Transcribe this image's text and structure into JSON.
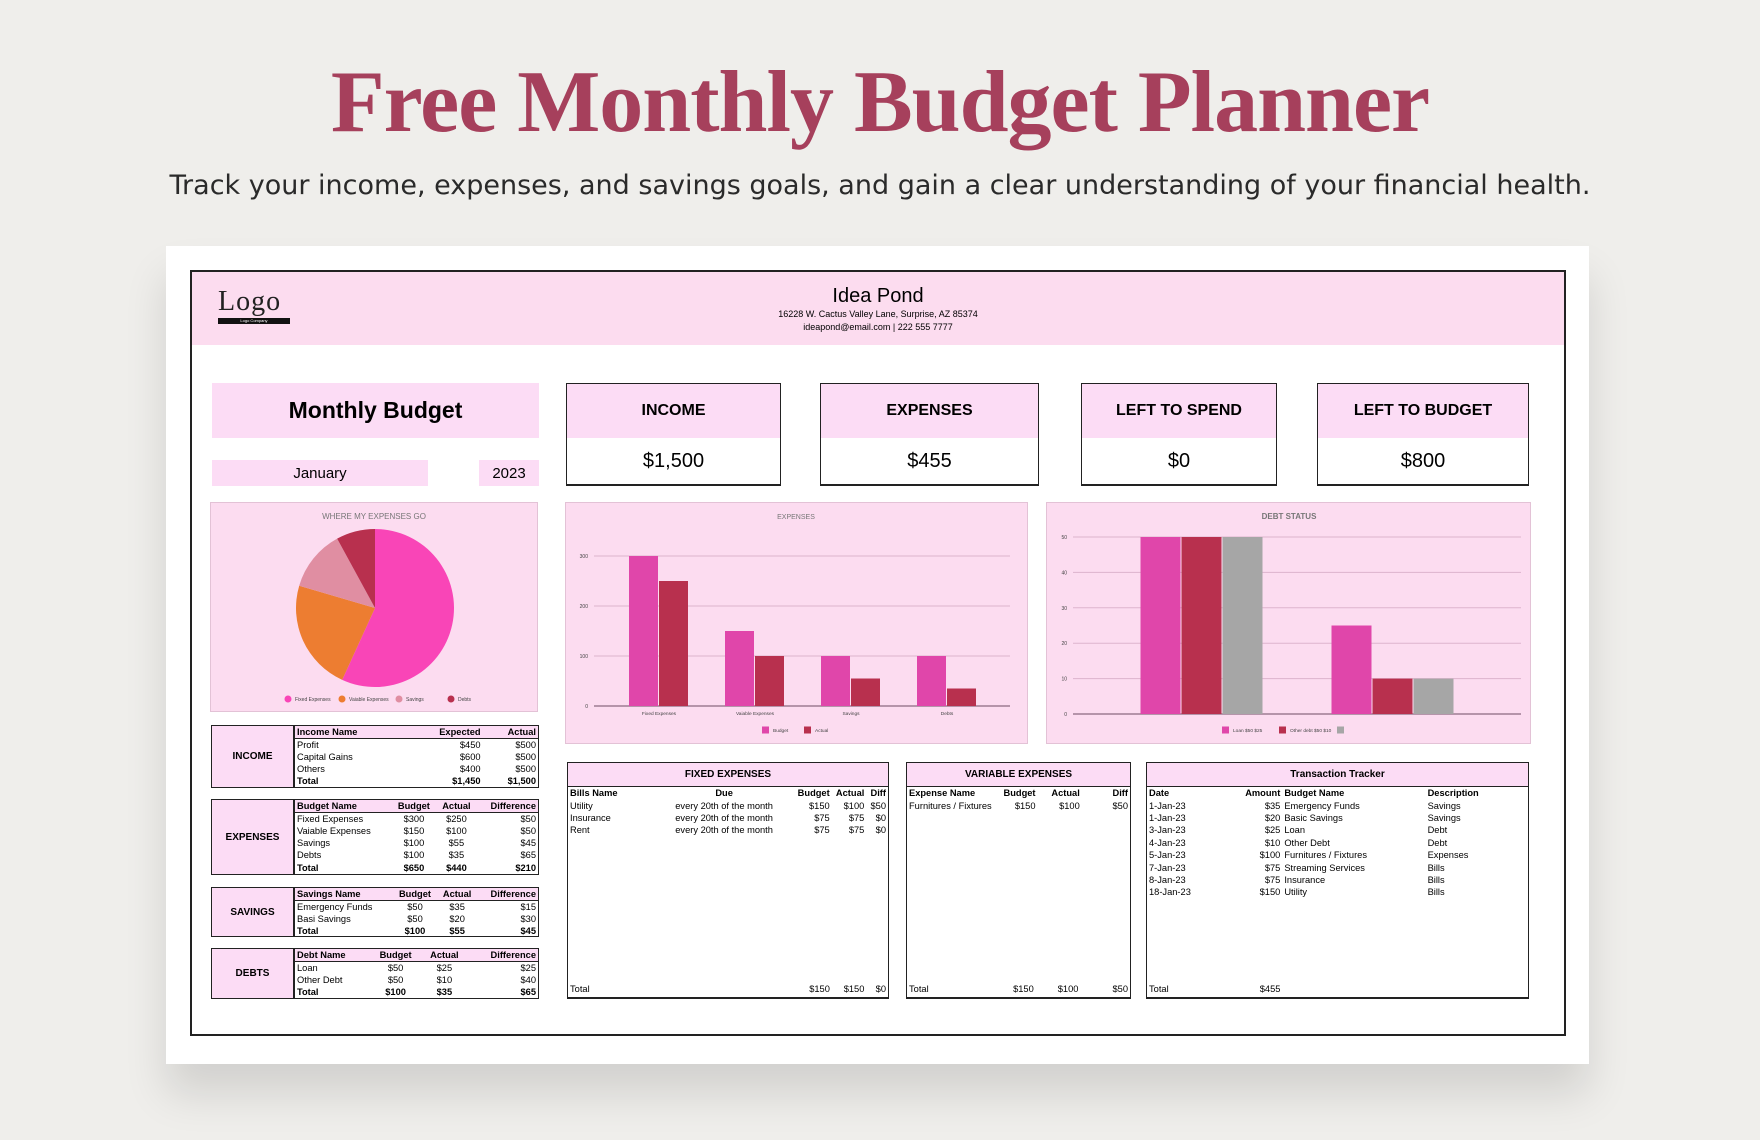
{
  "page": {
    "title": "Free Monthly Budget Planner",
    "subtitle": "Track your income, expenses, and savings goals, and gain a clear understanding of your financial health."
  },
  "header": {
    "logo": "Logo",
    "logo_tagline": "Logo Company",
    "company": "Idea Pond",
    "address": "16228 W. Cactus Valley Lane, Surprise, AZ 85374",
    "contact": "ideapond@email.com | 222 555 7777"
  },
  "budget": {
    "title": "Monthly Budget",
    "month": "January",
    "year": "2023"
  },
  "kpis": [
    {
      "label": "INCOME",
      "value": "$1,500"
    },
    {
      "label": "EXPENSES",
      "value": "$455"
    },
    {
      "label": "LEFT TO SPEND",
      "value": "$0"
    },
    {
      "label": "LEFT TO BUDGET",
      "value": "$800"
    }
  ],
  "colors": {
    "accent": "#a6405c",
    "pink_fill": "#fcdcf5",
    "series_pink": "#e046aa",
    "series_red": "#b8304e",
    "series_gray": "#a6a6a6"
  },
  "chart_data": [
    {
      "type": "pie",
      "title": "WHERE MY EXPENSES GO",
      "categories": [
        "Fixed Expenses",
        "Vaiable Expenses",
        "Savings",
        "Debts"
      ],
      "values": [
        250,
        100,
        55,
        35
      ],
      "colors": [
        "#f945b7",
        "#ed7d31",
        "#e08ea2",
        "#b8304e"
      ],
      "legend": "bottom"
    },
    {
      "type": "bar",
      "title": "EXPENSES",
      "categories": [
        "Fixed Expenses",
        "Vaiable Expenses",
        "Savings",
        "Debts"
      ],
      "series": [
        {
          "name": "Budget",
          "values": [
            300,
            150,
            100,
            100
          ],
          "color": "#e046aa"
        },
        {
          "name": "Actual",
          "values": [
            250,
            100,
            55,
            35
          ],
          "color": "#b8304e"
        }
      ],
      "ylim": [
        0,
        300
      ],
      "yticks": [
        0,
        100,
        200,
        300
      ],
      "grid": true,
      "legend": "bottom"
    },
    {
      "type": "bar",
      "title": "DEBT STATUS",
      "categories": [
        "",
        ""
      ],
      "series": [
        {
          "name": "Loan $50 $25",
          "values": [
            50,
            25
          ],
          "color": "#e046aa"
        },
        {
          "name": "Other debt $50 $10",
          "values": [
            50,
            10
          ],
          "color": "#b8304e"
        },
        {
          "name": "",
          "values": [
            50,
            10
          ],
          "color": "#a6a6a6"
        }
      ],
      "ylim": [
        0,
        50
      ],
      "yticks": [
        0,
        10,
        20,
        30,
        40,
        50
      ],
      "grid": true,
      "legend": "bottom"
    }
  ],
  "tables": {
    "income": {
      "label": "INCOME",
      "headers": [
        "Income Name",
        "Expected",
        "Actual"
      ],
      "rows": [
        [
          "Profit",
          "$450",
          "$500"
        ],
        [
          "Capital Gains",
          "$600",
          "$500"
        ],
        [
          "Others",
          "$400",
          "$500"
        ]
      ],
      "total": [
        "Total",
        "$1,450",
        "$1,500"
      ]
    },
    "expenses": {
      "label": "EXPENSES",
      "headers": [
        "Budget Name",
        "Budget",
        "Actual",
        "Difference"
      ],
      "rows": [
        [
          "Fixed Expenses",
          "$300",
          "$250",
          "$50"
        ],
        [
          "Vaiable Expenses",
          "$150",
          "$100",
          "$50"
        ],
        [
          "Savings",
          "$100",
          "$55",
          "$45"
        ],
        [
          "Debts",
          "$100",
          "$35",
          "$65"
        ]
      ],
      "total": [
        "Total",
        "$650",
        "$440",
        "$210"
      ]
    },
    "savings": {
      "label": "SAVINGS",
      "headers": [
        "Savings Name",
        "Budget",
        "Actual",
        "Difference"
      ],
      "rows": [
        [
          "Emergency Funds",
          "$50",
          "$35",
          "$15"
        ],
        [
          "Basi  Savings",
          "$50",
          "$20",
          "$30"
        ]
      ],
      "total": [
        "Total",
        "$100",
        "$55",
        "$45"
      ]
    },
    "debts": {
      "label": "DEBTS",
      "headers": [
        "Debt Name",
        "Budget",
        "Actual",
        "Difference"
      ],
      "rows": [
        [
          "Loan",
          "$50",
          "$25",
          "$25"
        ],
        [
          "Other Debt",
          "$50",
          "$10",
          "$40"
        ]
      ],
      "total": [
        "Total",
        "$100",
        "$35",
        "$65"
      ]
    }
  },
  "fixed": {
    "title": "FIXED EXPENSES",
    "headers": [
      "Bills Name",
      "Due",
      "Budget",
      "Actual",
      "Diff"
    ],
    "rows": [
      [
        "Utility",
        "every 20th of the month",
        "$150",
        "$100",
        "$50"
      ],
      [
        "Insurance",
        "every 20th of the month",
        "$75",
        "$75",
        "$0"
      ],
      [
        "Rent",
        "every 20th of the month",
        "$75",
        "$75",
        "$0"
      ]
    ],
    "total": [
      "Total",
      "",
      "$150",
      "$150",
      "$0"
    ]
  },
  "variable": {
    "title": "VARIABLE EXPENSES",
    "headers": [
      "Expense Name",
      "Budget",
      "Actual",
      "Diff"
    ],
    "rows": [
      [
        "Furnitures / Fixtures",
        "$150",
        "$100",
        "$50"
      ]
    ],
    "total": [
      "Total",
      "$150",
      "$100",
      "$50"
    ]
  },
  "transactions": {
    "title": "Transaction Tracker",
    "headers": [
      "Date",
      "Amount",
      "Budget Name",
      "Description"
    ],
    "rows": [
      [
        "1-Jan-23",
        "$35",
        "Emergency Funds",
        "Savings"
      ],
      [
        "1-Jan-23",
        "$20",
        "Basic Savings",
        "Savings"
      ],
      [
        "3-Jan-23",
        "$25",
        "Loan",
        "Debt"
      ],
      [
        "4-Jan-23",
        "$10",
        "Other Debt",
        "Debt"
      ],
      [
        "5-Jan-23",
        "$100",
        "Furnitures / Fixtures",
        "Expenses"
      ],
      [
        "7-Jan-23",
        "$75",
        "Streaming Services",
        "Bills"
      ],
      [
        "8-Jan-23",
        "$75",
        "Insurance",
        "Bills"
      ],
      [
        "18-Jan-23",
        "$150",
        "Utility",
        "Bills"
      ]
    ],
    "total": [
      "Total",
      "$455",
      "",
      ""
    ]
  }
}
